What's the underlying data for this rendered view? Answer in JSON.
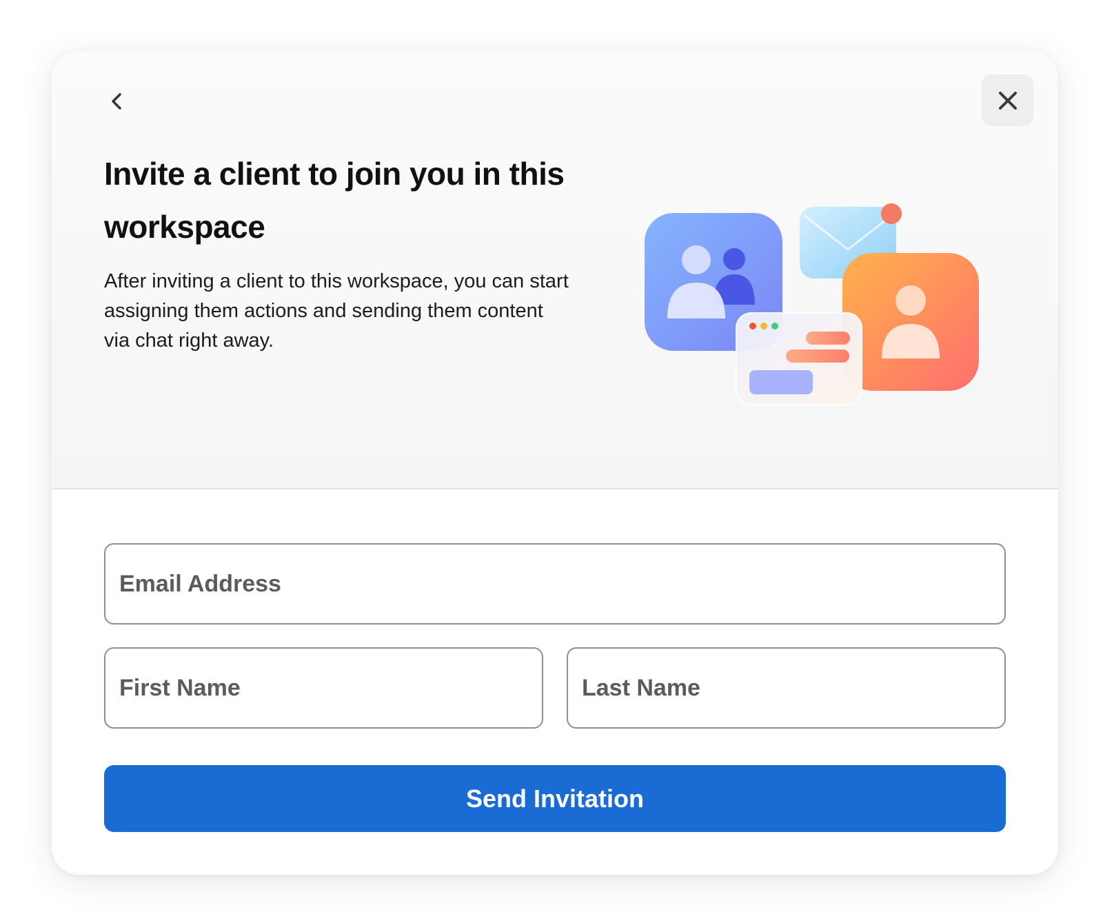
{
  "header": {
    "back_icon": "chevron-left-icon",
    "close_icon": "close-icon"
  },
  "hero": {
    "title": "Invite a client to join you in this workspace",
    "description": "After inviting a client to this workspace, you can start assigning them actions and sending them content via chat right away."
  },
  "form": {
    "email_placeholder": "Email Address",
    "first_name_placeholder": "First Name",
    "last_name_placeholder": "Last Name",
    "submit_label": "Send Invitation"
  },
  "colors": {
    "primary_button": "#1a6bd4",
    "hero_background": "#f7f7f7",
    "input_border": "#8f8f8f"
  }
}
